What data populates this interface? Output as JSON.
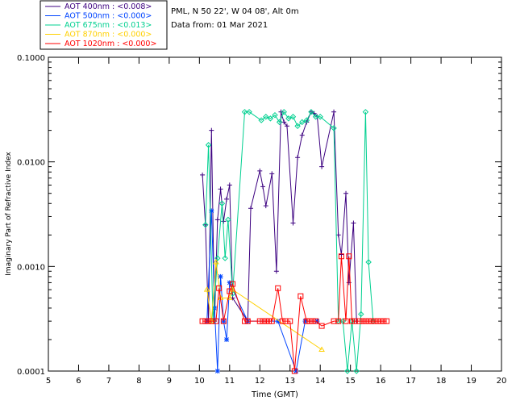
{
  "chart_data": {
    "type": "line",
    "title_lines": [
      "PML, N 50 22', W 04 08', Alt 0m",
      "Data from: 01 Mar 2021"
    ],
    "xlabel": "Time (GMT)",
    "ylabel": "Imaginary Part of Refractive Index",
    "xlim": [
      5,
      20
    ],
    "ylim": [
      0.0001,
      0.1
    ],
    "yscale": "log",
    "x_ticks": [
      "5",
      "6",
      "7",
      "8",
      "9",
      "10",
      "11",
      "12",
      "13",
      "14",
      "15",
      "16",
      "17",
      "18",
      "19",
      "20"
    ],
    "y_ticks": [
      {
        "value": 0.1,
        "label": "0.1000"
      },
      {
        "value": 0.01,
        "label": "0.0100"
      },
      {
        "value": 0.001,
        "label": "0.0010"
      },
      {
        "value": 0.0001,
        "label": "0.0001"
      }
    ],
    "grid": false,
    "legend_position": "top-left (outside plot)",
    "series": [
      {
        "name": "AOT  400nm : <0.008>",
        "color": "#3c0080",
        "marker": "plus",
        "points": [
          [
            10.1,
            0.0075
          ],
          [
            10.2,
            0.0025
          ],
          [
            10.3,
            0.0003
          ],
          [
            10.4,
            0.02
          ],
          [
            10.5,
            0.0003
          ],
          [
            10.6,
            0.0028
          ],
          [
            10.7,
            0.0055
          ],
          [
            10.8,
            0.0027
          ],
          [
            10.9,
            0.0044
          ],
          [
            11.0,
            0.006
          ],
          [
            11.1,
            0.0005
          ],
          [
            11.6,
            0.0003
          ],
          [
            11.7,
            0.0036
          ],
          [
            12.0,
            0.0082
          ],
          [
            12.1,
            0.0058
          ],
          [
            12.2,
            0.0038
          ],
          [
            12.4,
            0.0077
          ],
          [
            12.55,
            0.0009
          ],
          [
            12.7,
            0.03
          ],
          [
            12.8,
            0.024
          ],
          [
            12.9,
            0.022
          ],
          [
            13.1,
            0.0026
          ],
          [
            13.25,
            0.011
          ],
          [
            13.4,
            0.018
          ],
          [
            13.55,
            0.024
          ],
          [
            13.7,
            0.03
          ],
          [
            13.8,
            0.029
          ],
          [
            13.9,
            0.027
          ],
          [
            14.05,
            0.009
          ],
          [
            14.45,
            0.03
          ],
          [
            14.6,
            0.002
          ],
          [
            14.7,
            0.0013
          ],
          [
            14.85,
            0.005
          ],
          [
            14.95,
            0.0007
          ],
          [
            15.1,
            0.0026
          ],
          [
            15.2,
            0.0003
          ]
        ]
      },
      {
        "name": "AOT  500nm : <0.000>",
        "color": "#0044ff",
        "marker": "asterisk",
        "points": [
          [
            10.25,
            0.0003
          ],
          [
            10.4,
            0.0034
          ],
          [
            10.5,
            0.0004
          ],
          [
            10.6,
            0.0001
          ],
          [
            10.7,
            0.0008
          ],
          [
            10.8,
            0.0003
          ],
          [
            10.9,
            0.0002
          ],
          [
            11.0,
            0.0007
          ],
          [
            11.6,
            0.0003
          ],
          [
            12.6,
            0.0003
          ],
          [
            13.2,
            0.0001
          ],
          [
            13.5,
            0.0003
          ],
          [
            13.9,
            0.0003
          ]
        ]
      },
      {
        "name": "AOT  675nm : <0.013>",
        "color": "#00d090",
        "marker": "diamond",
        "points": [
          [
            10.2,
            0.0025
          ],
          [
            10.3,
            0.0145
          ],
          [
            10.45,
            0.0003
          ],
          [
            10.6,
            0.0012
          ],
          [
            10.75,
            0.004
          ],
          [
            10.85,
            0.0012
          ],
          [
            10.95,
            0.0028
          ],
          [
            11.1,
            0.00055
          ],
          [
            11.5,
            0.03
          ],
          [
            11.65,
            0.03
          ],
          [
            12.05,
            0.025
          ],
          [
            12.2,
            0.027
          ],
          [
            12.35,
            0.026
          ],
          [
            12.5,
            0.028
          ],
          [
            12.65,
            0.024
          ],
          [
            12.8,
            0.03
          ],
          [
            12.95,
            0.026
          ],
          [
            13.1,
            0.027
          ],
          [
            13.25,
            0.022
          ],
          [
            13.4,
            0.024
          ],
          [
            13.55,
            0.025
          ],
          [
            13.7,
            0.03
          ],
          [
            13.85,
            0.027
          ],
          [
            14.0,
            0.027
          ],
          [
            14.45,
            0.021
          ],
          [
            14.6,
            0.0003
          ],
          [
            14.75,
            0.0003
          ],
          [
            14.9,
            0.0001
          ],
          [
            15.05,
            0.0003
          ],
          [
            15.2,
            0.0001
          ],
          [
            15.35,
            0.00035
          ],
          [
            15.5,
            0.03
          ],
          [
            15.6,
            0.0011
          ],
          [
            15.75,
            0.0003
          ]
        ]
      },
      {
        "name": "AOT  870nm : <0.000>",
        "color": "#ffd000",
        "marker": "triangle",
        "points": [
          [
            10.25,
            0.0006
          ],
          [
            10.4,
            0.0003
          ],
          [
            10.55,
            0.0011
          ],
          [
            10.7,
            0.0005
          ],
          [
            11.0,
            0.0005
          ],
          [
            11.1,
            0.0006
          ],
          [
            14.05,
            0.00016
          ]
        ]
      },
      {
        "name": "AOT 1020nm : <0.000>",
        "color": "#ff0000",
        "marker": "square",
        "points": [
          [
            10.1,
            0.0003
          ],
          [
            10.2,
            0.0003
          ],
          [
            10.3,
            0.0003
          ],
          [
            10.4,
            0.0003
          ],
          [
            10.55,
            0.0003
          ],
          [
            10.65,
            0.00062
          ],
          [
            10.8,
            0.0003
          ],
          [
            11.0,
            0.00058
          ],
          [
            11.1,
            0.00068
          ],
          [
            11.5,
            0.0003
          ],
          [
            11.6,
            0.0003
          ],
          [
            12.0,
            0.0003
          ],
          [
            12.1,
            0.0003
          ],
          [
            12.2,
            0.0003
          ],
          [
            12.3,
            0.0003
          ],
          [
            12.4,
            0.0003
          ],
          [
            12.6,
            0.00062
          ],
          [
            12.75,
            0.0003
          ],
          [
            12.85,
            0.0003
          ],
          [
            13.0,
            0.0003
          ],
          [
            13.15,
            0.0001
          ],
          [
            13.35,
            0.00052
          ],
          [
            13.55,
            0.0003
          ],
          [
            13.65,
            0.0003
          ],
          [
            13.75,
            0.0003
          ],
          [
            13.85,
            0.0003
          ],
          [
            14.05,
            0.00027
          ],
          [
            14.45,
            0.0003
          ],
          [
            14.6,
            0.0003
          ],
          [
            14.7,
            0.00125
          ],
          [
            14.85,
            0.0003
          ],
          [
            14.95,
            0.00125
          ],
          [
            15.05,
            0.0003
          ],
          [
            15.15,
            0.0003
          ],
          [
            15.3,
            0.0003
          ],
          [
            15.4,
            0.0003
          ],
          [
            15.5,
            0.0003
          ],
          [
            15.6,
            0.0003
          ],
          [
            15.7,
            0.0003
          ],
          [
            15.8,
            0.0003
          ],
          [
            15.9,
            0.0003
          ],
          [
            16.0,
            0.0003
          ],
          [
            16.1,
            0.0003
          ],
          [
            16.2,
            0.0003
          ]
        ]
      }
    ]
  }
}
